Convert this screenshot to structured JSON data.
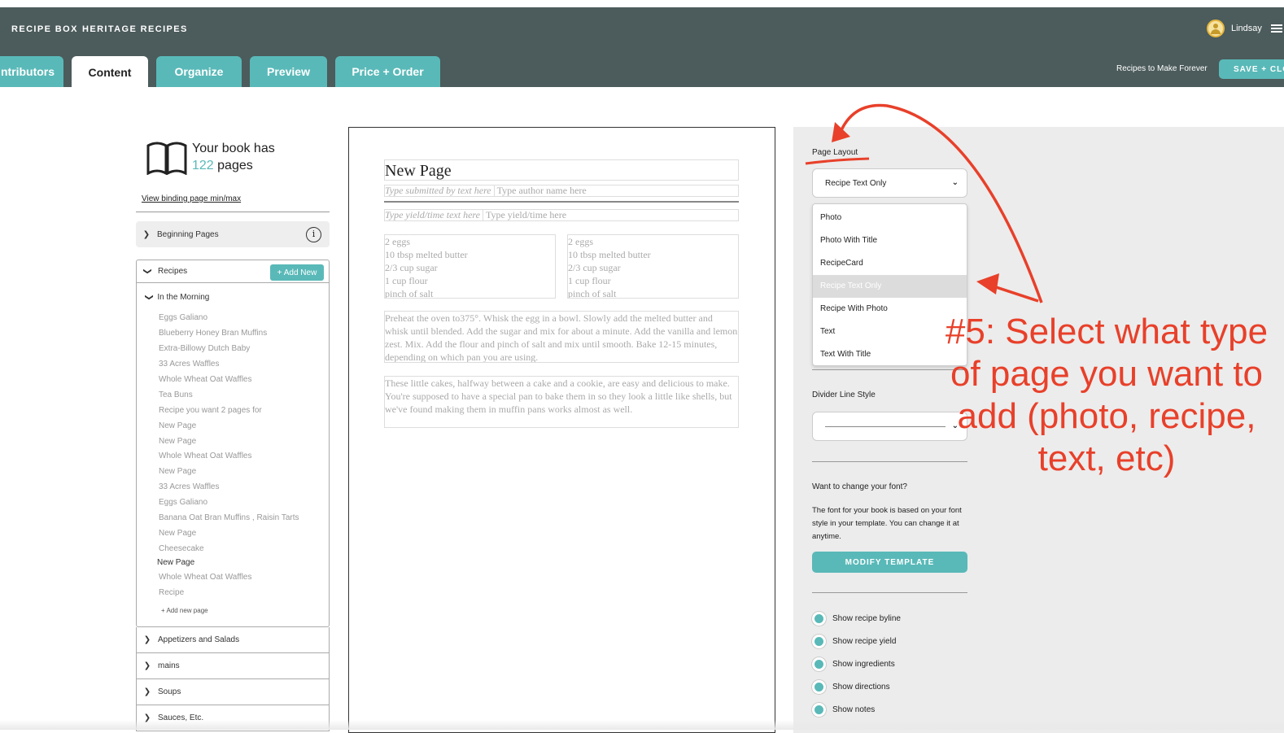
{
  "header": {
    "brand_1": "RECIPE BOX",
    "brand_2": "HERITAGE RECIPES",
    "user_name": "Lindsay",
    "slogan": "Recipes to Make Forever",
    "save_label": "SAVE + CLO"
  },
  "tabs": [
    {
      "label": "ntributors"
    },
    {
      "label": "Content"
    },
    {
      "label": "Organize"
    },
    {
      "label": "Preview"
    },
    {
      "label": "Price + Order"
    }
  ],
  "sidebar": {
    "book_line1": "Your book has",
    "page_count": "122",
    "pages_word": " pages",
    "binding_link": "View binding page min/max",
    "beginning_pages": "Beginning Pages",
    "info_glyph": "i",
    "recipes_label": "Recipes",
    "add_new": "+ Add New",
    "subsection": "In the Morning",
    "recipe_items": [
      "Eggs Galiano",
      "Blueberry Honey Bran Muffins",
      "Extra-Billowy Dutch Baby",
      "33 Acres Waffles",
      "Whole Wheat Oat Waffles",
      "Tea Buns",
      "Recipe you want 2 pages for",
      "New Page",
      "New Page",
      "Whole Wheat Oat Waffles",
      "New Page",
      "33 Acres Waffles",
      "Eggs Galiano",
      "Banana Oat Bran Muffins , Raisin Tarts",
      "New Page",
      "Cheesecake",
      "New Page",
      "Whole Wheat Oat Waffles",
      "Recipe"
    ],
    "add_new_page": "+ Add new page",
    "sections": [
      "Appetizers and Salads",
      "mains",
      "Soups",
      "Sauces, Etc."
    ]
  },
  "page": {
    "title": "New Page",
    "submitted_placeholder": "Type submitted by text here",
    "author_placeholder": "Type author name here",
    "yield_placeholder": "Type yield/time text here",
    "yield_value_placeholder": "Type yield/time here",
    "ingredients_left": "2 eggs\n10 tbsp melted butter\n2/3 cup sugar\n1 cup flour\npinch of salt",
    "ingredients_right": "2 eggs\n10 tbsp melted butter\n2/3 cup sugar\n1 cup flour\npinch of salt",
    "directions": "Preheat the oven to375°. Whisk the egg in a bowl. Slowly add the melted butter and whisk until blended. Add the sugar and mix for about a minute. Add the vanilla and lemon zest. Mix. Add the flour and pinch of salt and mix until smooth. Bake 12-15 minutes, depending on which pan you are using.",
    "notes": "These little cakes, halfway between a cake and a cookie, are easy and delicious to make. You're supposed to have a special pan to bake them in so they look a little like shells, but we've found making them in muffin pans works almost as well."
  },
  "settings": {
    "page_layout_label": "Page Layout",
    "layout_selected": "Recipe Text Only",
    "layout_options": [
      "Photo",
      "Photo With Title",
      "RecipeCard",
      "Recipe Text Only",
      "Recipe With Photo",
      "Text",
      "Text With Title"
    ],
    "divider_label": "Divider Line Style",
    "font_question": "Want to change your font?",
    "font_text": "The font for your book is based on your font style in your template. You can change it at anytime.",
    "modify_template": "MODIFY TEMPLATE",
    "toggles": [
      "Show recipe byline",
      "Show recipe yield",
      "Show ingredients",
      "Show directions",
      "Show notes"
    ]
  },
  "annotation": {
    "text": "#5: Select what type of page you want to add (photo, recipe, text, etc)",
    "color": "#e8402a"
  },
  "colors": {
    "header_bg": "#4c5b5b",
    "accent_teal": "#59b9b8"
  }
}
